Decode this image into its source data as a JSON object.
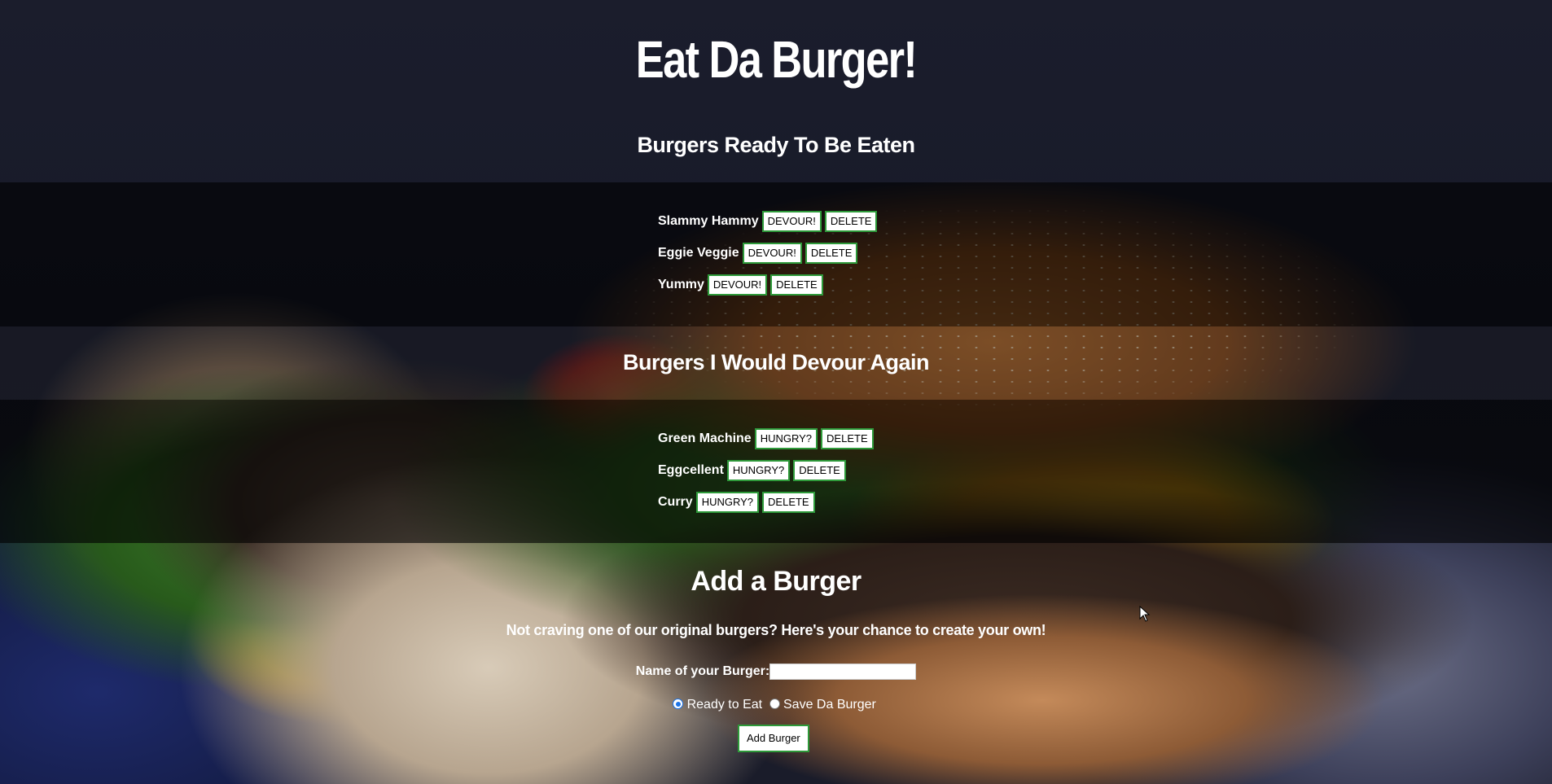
{
  "header": {
    "title": "Eat Da Burger!"
  },
  "ready_section": {
    "heading": "Burgers Ready To Be Eaten",
    "burgers": [
      {
        "name": "Slammy Hammy",
        "action": "DEVOUR!",
        "delete": "DELETE"
      },
      {
        "name": "Eggie Veggie",
        "action": "DEVOUR!",
        "delete": "DELETE"
      },
      {
        "name": "Yummy",
        "action": "DEVOUR!",
        "delete": "DELETE"
      }
    ]
  },
  "devoured_section": {
    "heading": "Burgers I Would Devour Again",
    "burgers": [
      {
        "name": "Green Machine",
        "action": "HUNGRY?",
        "delete": "DELETE"
      },
      {
        "name": "Eggcellent",
        "action": "HUNGRY?",
        "delete": "DELETE"
      },
      {
        "name": "Curry",
        "action": "HUNGRY?",
        "delete": "DELETE"
      }
    ]
  },
  "add_section": {
    "heading": "Add a Burger",
    "subtitle": "Not craving one of our original burgers? Here's your chance to create your own!",
    "name_label": "Name of your Burger:",
    "name_value": "",
    "radio_options": [
      {
        "label": "Ready to Eat",
        "checked": true
      },
      {
        "label": "Save Da Burger",
        "checked": false
      }
    ],
    "submit_label": "Add Burger"
  },
  "colors": {
    "button_border": "#2e9a3a",
    "radio_selected": "#1a73e8"
  }
}
